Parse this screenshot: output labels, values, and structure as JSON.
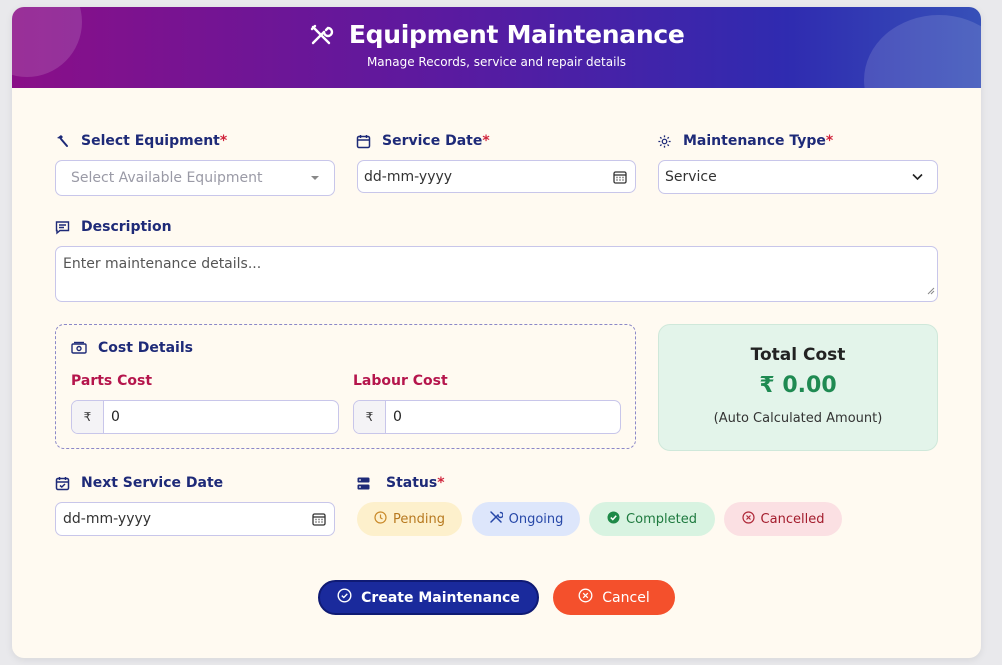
{
  "header": {
    "title": "Equipment Maintenance",
    "subtitle": "Manage Records, service and repair details"
  },
  "fields": {
    "equipment": {
      "label": "Select Equipment",
      "placeholder": "Select Available Equipment"
    },
    "service_date": {
      "label": "Service Date",
      "value": "dd-mm-yyyy"
    },
    "maintenance_type": {
      "label": "Maintenance Type",
      "value": "Service"
    },
    "description": {
      "label": "Description",
      "placeholder": "Enter maintenance details..."
    },
    "next_service_date": {
      "label": "Next Service Date",
      "value": "dd-mm-yyyy"
    },
    "status": {
      "label": "Status"
    }
  },
  "required_mark": "*",
  "cost": {
    "title": "Cost Details",
    "currency_symbol": "₹",
    "parts": {
      "label": "Parts Cost",
      "value": "0"
    },
    "labour": {
      "label": "Labour Cost",
      "value": "0"
    }
  },
  "total": {
    "title": "Total Cost",
    "value": "₹ 0.00",
    "note": "(Auto Calculated Amount)"
  },
  "status_options": [
    {
      "label": "Pending",
      "icon": "clock-icon",
      "bg": "#fdf0cc",
      "color": "#b7791f"
    },
    {
      "label": "Ongoing",
      "icon": "tools-icon",
      "bg": "#dde6fb",
      "color": "#2748a8"
    },
    {
      "label": "Completed",
      "icon": "check-circle-icon",
      "bg": "#d8f3e1",
      "color": "#1e7a3f"
    },
    {
      "label": "Cancelled",
      "icon": "x-circle-icon",
      "bg": "#fbe0e3",
      "color": "#a31c2c"
    }
  ],
  "actions": {
    "create": "Create Maintenance",
    "cancel": "Cancel"
  },
  "colors": {
    "primary_button": "#1a2a9c",
    "cancel_button": "#f4502c",
    "label_text": "#1e2a78",
    "total_value": "#1f8a52"
  }
}
